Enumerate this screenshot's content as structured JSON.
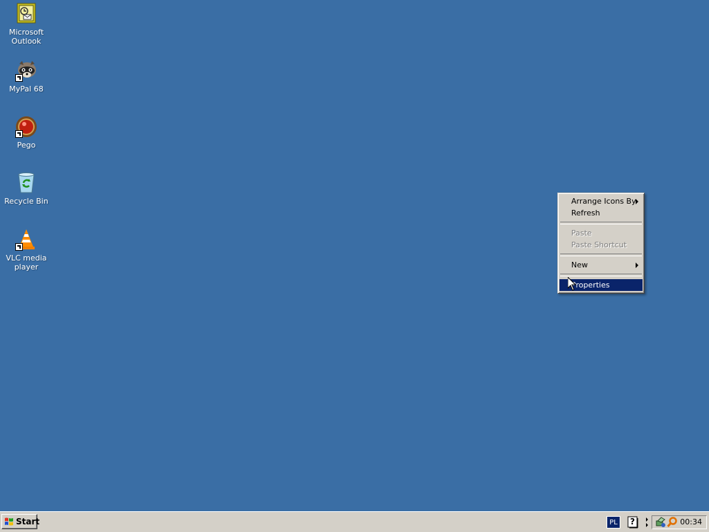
{
  "desktop": {
    "background_color": "#3a6ea5",
    "icons": [
      {
        "label": "Microsoft\nOutlook",
        "icon": "outlook-icon",
        "shortcut": false
      },
      {
        "label": "MyPal 68",
        "icon": "mypal-raccoon-icon",
        "shortcut": true
      },
      {
        "label": "Pego",
        "icon": "pego-icon",
        "shortcut": true
      },
      {
        "label": "Recycle Bin",
        "icon": "recycle-bin-icon",
        "shortcut": false
      },
      {
        "label": "VLC media\nplayer",
        "icon": "vlc-cone-icon",
        "shortcut": true
      }
    ]
  },
  "context_menu": {
    "items": [
      {
        "label": "Arrange Icons By",
        "enabled": true,
        "submenu": true
      },
      {
        "label": "Refresh",
        "enabled": true,
        "submenu": false
      },
      {
        "label": "Paste",
        "enabled": false,
        "submenu": false
      },
      {
        "label": "Paste Shortcut",
        "enabled": false,
        "submenu": false
      },
      {
        "label": "New",
        "enabled": true,
        "submenu": true
      },
      {
        "label": "Properties",
        "enabled": true,
        "submenu": false,
        "selected": true
      }
    ],
    "highlight_color": "#0a246a"
  },
  "taskbar": {
    "start_label": "Start",
    "language": "PL",
    "help_glyph": "?",
    "clock": "00:34"
  }
}
